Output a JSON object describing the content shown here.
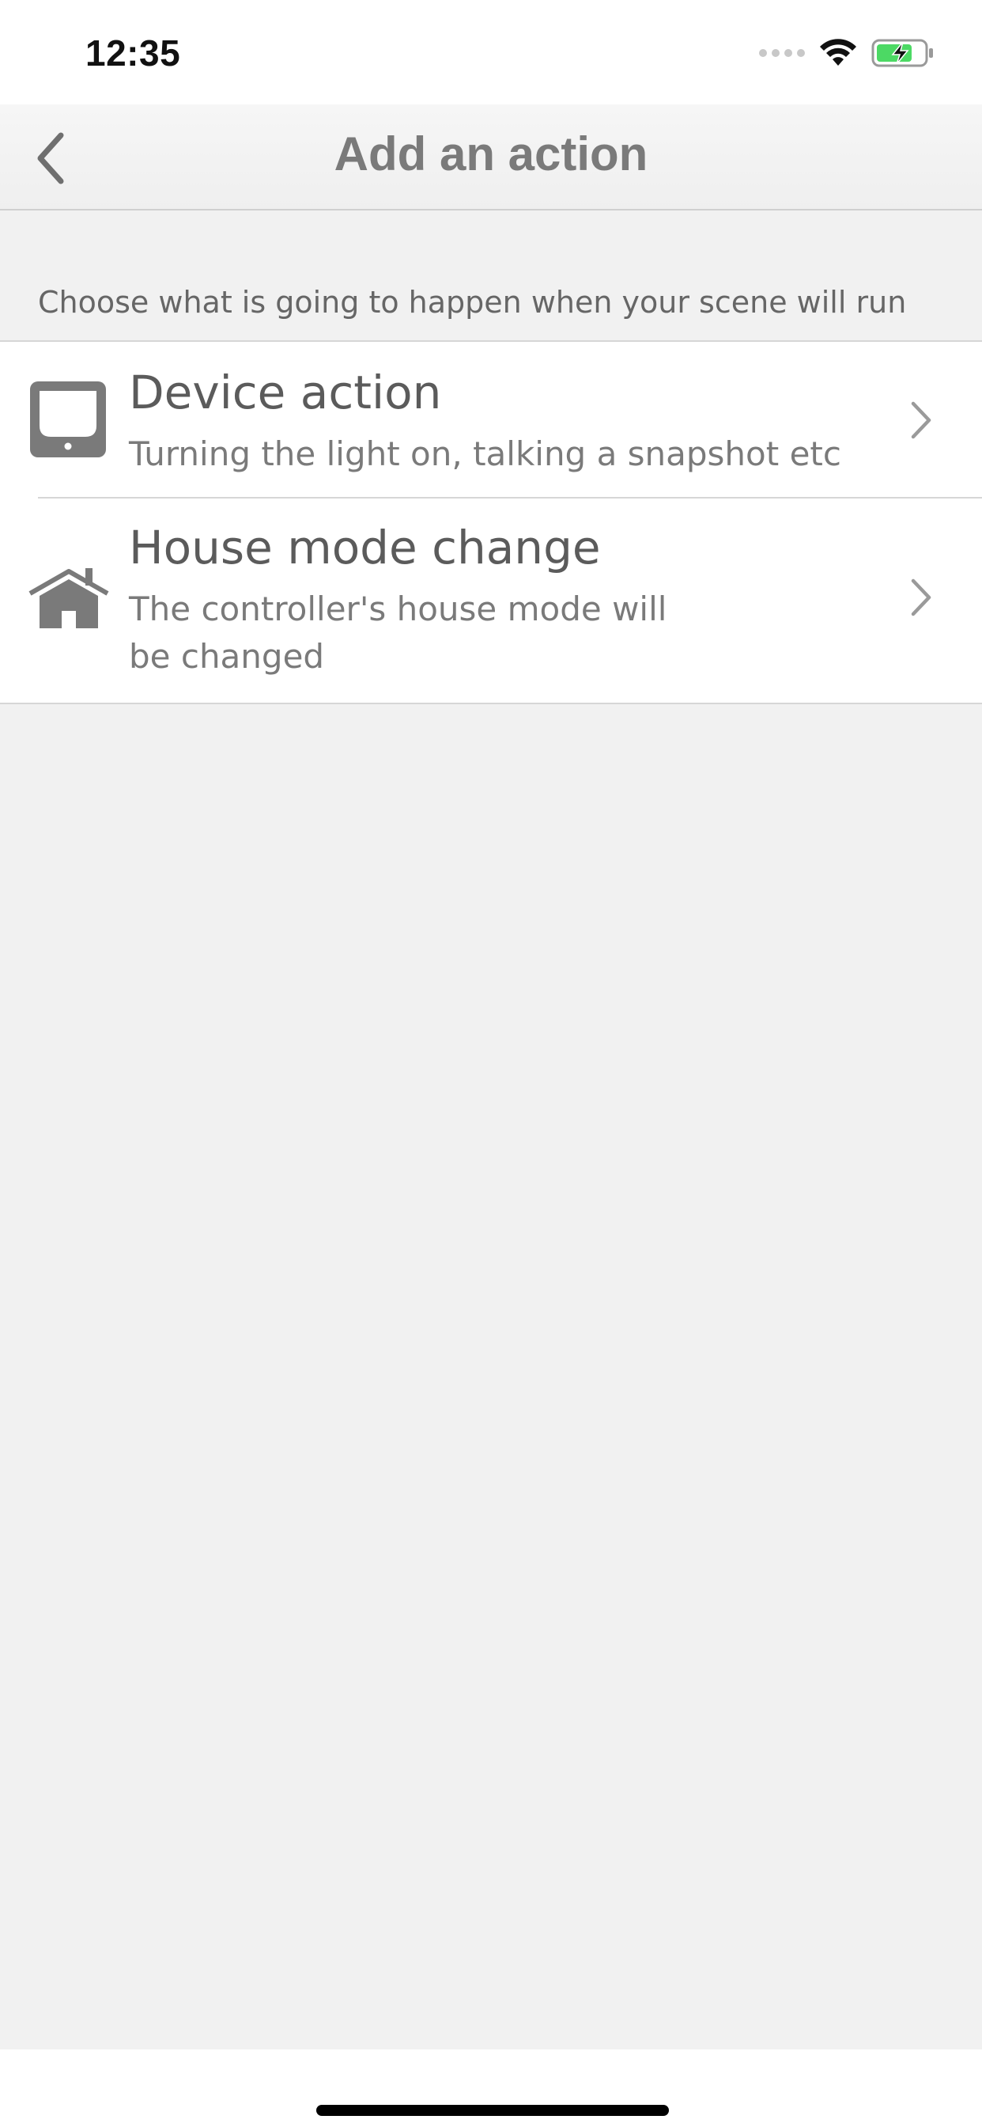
{
  "status_bar": {
    "time": "12:35",
    "icons": [
      "signal-dots-icon",
      "wifi-icon",
      "battery-charging-icon"
    ],
    "battery_color": "#4cd964"
  },
  "nav": {
    "title": "Add an action",
    "back_icon": "chevron-left-icon"
  },
  "instruction": "Choose what is going to happen when your scene will run",
  "actions": [
    {
      "title": "Device action",
      "subtitle": "Turning the light on, talking a snapshot etc",
      "icon": "device-icon"
    },
    {
      "title": "House mode change",
      "subtitle": "The controller's house mode will be changed",
      "icon": "house-icon"
    }
  ],
  "colors": {
    "background": "#f1f1f1",
    "row_background": "#ffffff",
    "title_text": "#5b5b5b",
    "subtitle_text": "#7a7a7a",
    "icon": "#7a7a7a",
    "divider": "#d6d6d6"
  }
}
